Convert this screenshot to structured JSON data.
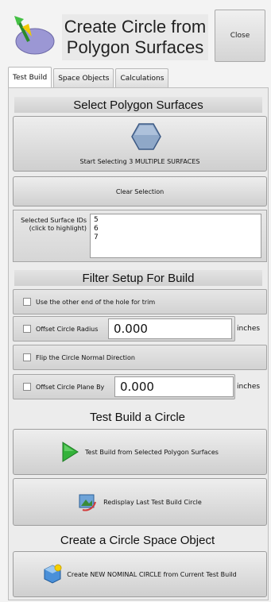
{
  "header": {
    "title": "Create Circle from Polygon Surfaces",
    "close_label": "Close"
  },
  "tabs": [
    {
      "label": "Test Build",
      "active": true
    },
    {
      "label": "Space Objects",
      "active": false
    },
    {
      "label": "Calculations",
      "active": false
    }
  ],
  "select_section": {
    "heading": "Select Polygon Surfaces",
    "start_button_label": "Start Selecting 3  MULTIPLE SURFACES",
    "clear_button_label": "Clear Selection",
    "ids_label": "Selected Surface IDs (click to highlight)",
    "surface_ids": [
      "5",
      "6",
      "7"
    ]
  },
  "filter_section": {
    "heading": "Filter Setup For Build",
    "use_other_end_label": "Use the other end of the hole for trim",
    "use_other_end_checked": false,
    "offset_radius_label": "Offset Circle Radius",
    "offset_radius_checked": false,
    "offset_radius_value": "0.000",
    "offset_radius_unit": "inches",
    "flip_normal_label": "Flip the Circle Normal Direction",
    "flip_normal_checked": false,
    "offset_plane_label": "Offset Circle Plane By",
    "offset_plane_checked": false,
    "offset_plane_value": "0.000",
    "offset_plane_unit": "inches"
  },
  "test_build_section": {
    "heading": "Test Build a Circle",
    "test_build_label": "Test Build from Selected Polygon Surfaces",
    "redisplay_label": "Redisplay Last Test Build Circle"
  },
  "create_section": {
    "heading": "Create a Circle Space Object",
    "create_label": "Create NEW NOMINAL CIRCLE from Current Test Build"
  },
  "colors": {
    "panel_bg": "#ececec",
    "accent_green": "#34b23a",
    "icon_purple": "#9b97d4"
  }
}
